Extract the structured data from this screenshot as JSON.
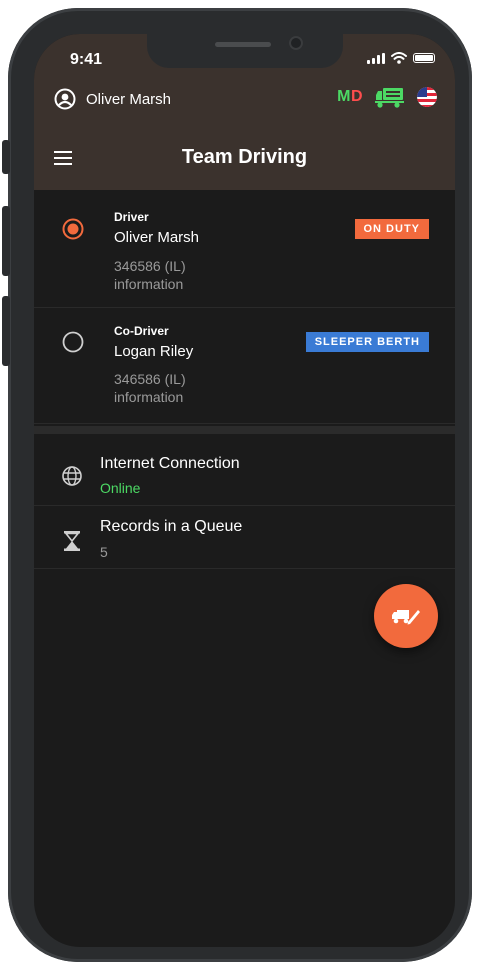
{
  "status_bar": {
    "time": "9:41"
  },
  "header": {
    "user_name": "Oliver Marsh",
    "md_m": "M",
    "md_d": "D",
    "title": "Team Driving"
  },
  "drivers": [
    {
      "role": "Driver",
      "name": "Oliver Marsh",
      "license": "346586 (IL)",
      "info": "information",
      "status": "ON DUTY",
      "status_color": "#f26a3d",
      "selected": true
    },
    {
      "role": "Co-Driver",
      "name": "Logan Riley",
      "license": "346586 (IL)",
      "info": "information",
      "status": "SLEEPER BERTH",
      "status_color": "#3a7bd5",
      "selected": false
    }
  ],
  "info": {
    "internet": {
      "label": "Internet Connection",
      "value": "Online",
      "value_color": "#4cd964"
    },
    "queue": {
      "label": "Records in a Queue",
      "value": "5"
    }
  },
  "icons": {
    "user": "user-circle-icon",
    "truck": "truck-icon",
    "flag": "us-flag-icon",
    "menu": "menu-icon",
    "globe": "globe-icon",
    "hourglass": "hourglass-icon",
    "fab": "truck-edit-icon"
  }
}
